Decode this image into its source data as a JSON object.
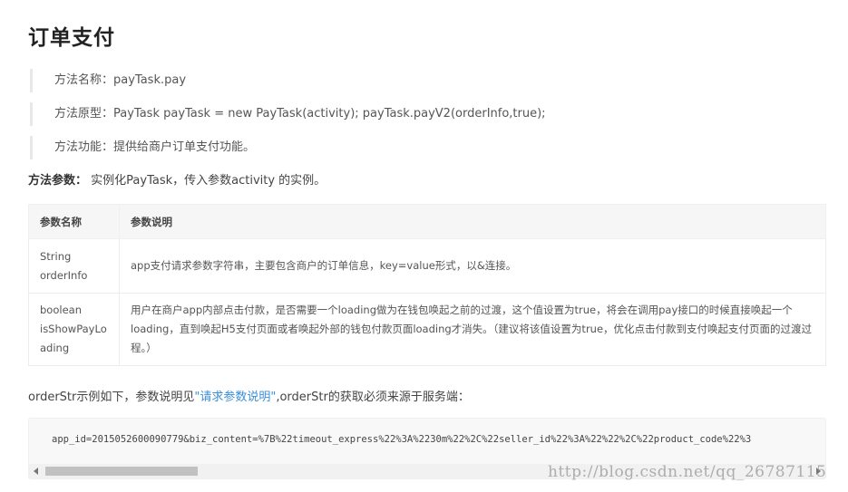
{
  "title": "订单支付",
  "quotes": [
    "方法名称：payTask.pay",
    "方法原型：PayTask payTask = new PayTask(activity); payTask.payV2(orderInfo,true);",
    "方法功能：提供给商户订单支付功能。"
  ],
  "params_intro": {
    "label": "方法参数：",
    "text": " 实例化PayTask，传入参数activity 的实例。"
  },
  "table": {
    "headers": [
      "参数名称",
      "参数说明"
    ],
    "rows": [
      {
        "name_lines": [
          "String",
          "orderInfo"
        ],
        "desc": "app支付请求参数字符串，主要包含商户的订单信息，key=value形式，以&连接。"
      },
      {
        "name_lines": [
          "boolean",
          "isShowPayLo",
          "ading"
        ],
        "desc": "用户在商户app内部点击付款，是否需要一个loading做为在钱包唤起之前的过渡，这个值设置为true，将会在调用pay接口的时候直接唤起一个loading，直到唤起H5支付页面或者唤起外部的钱包付款页面loading才消失。（建议将该值设置为true，优化点击付款到支付唤起支付页面的过渡过程。）"
      }
    ]
  },
  "order_line": {
    "before": "orderStr示例如下，参数说明见",
    "link": "\"请求参数说明\"",
    "after": ",orderStr的获取必须来源于服务端："
  },
  "code": "app_id=2015052600090779&biz_content=%7B%22timeout_express%22%3A%2230m%22%2C%22seller_id%22%3A%22%22%2C%22product_code%22%3",
  "watermark": "http://blog.csdn.net/qq_26787115",
  "colors": {
    "link": "#3a8ed8",
    "code_bg": "#f8f8f8",
    "table_header_bg": "#f6f6f6"
  }
}
